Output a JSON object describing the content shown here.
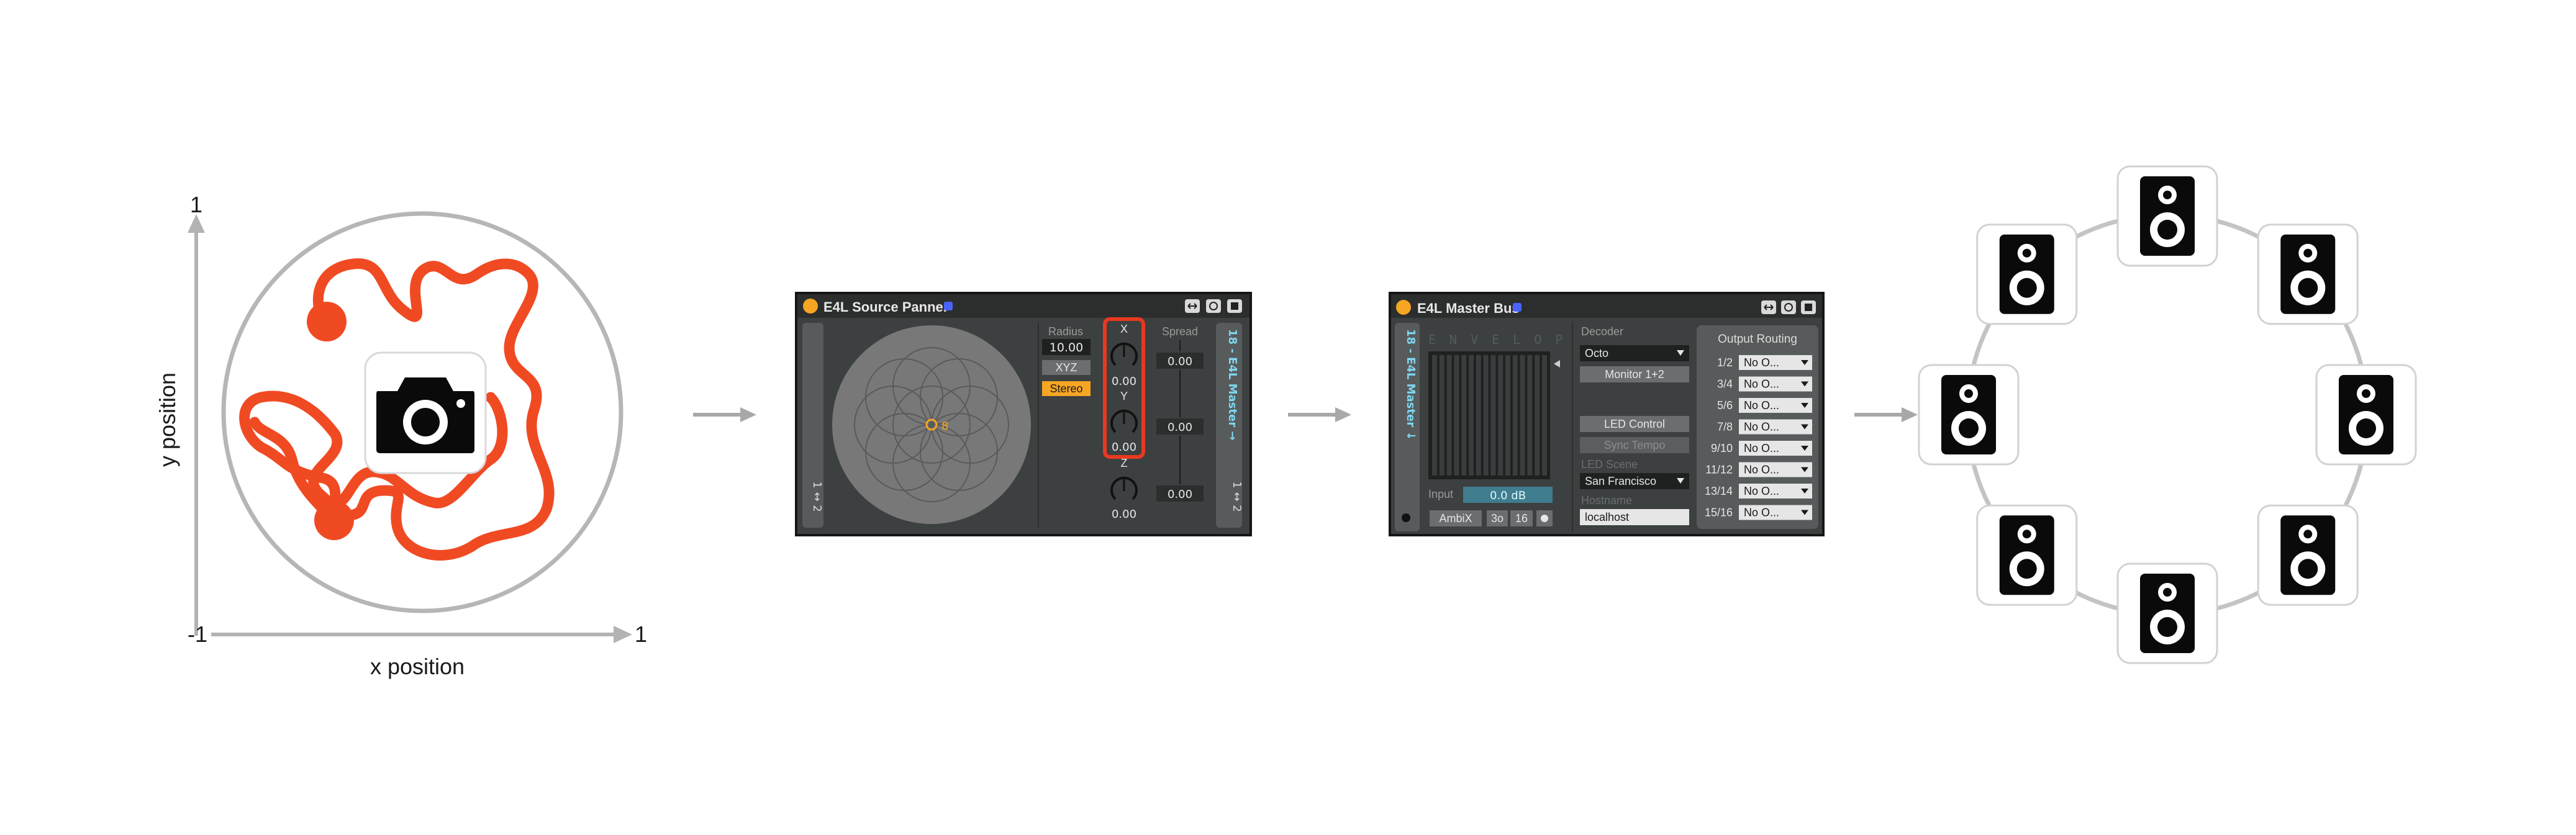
{
  "xy_plot": {
    "y_top_tick": "1",
    "y_label": "y position",
    "x_left_tick": "-1",
    "x_right_tick": "1",
    "x_label": "x position",
    "center_icon": "camera-icon",
    "path_color": "#f04a23"
  },
  "source_panner": {
    "title": "E4L Source Panner",
    "header_buttons": [
      "expand-icon",
      "refresh-icon",
      "save-icon"
    ],
    "left_strip_label": "1 ↔ 2",
    "right_strip_label_top": "18 - E4L Master →",
    "right_strip_label_bottom": "1 ↔ 2",
    "center_marker_label": "8",
    "radius_label": "Radius",
    "radius_value": "10.00",
    "xyz_button": "XYZ",
    "stereo_button": "Stereo",
    "knobs": [
      {
        "label": "X",
        "value": "0.00"
      },
      {
        "label": "Y",
        "value": "0.00"
      },
      {
        "label": "Z",
        "value": "0.00"
      }
    ],
    "spread_label": "Spread",
    "spread_values": [
      "0.00",
      "0.00",
      "0.00"
    ]
  },
  "master_bus": {
    "title": "E4L Master Bus",
    "header_buttons": [
      "expand-icon",
      "refresh-icon",
      "save-icon"
    ],
    "side_strip_label": "18 - E4L Master ↓",
    "logo_text": "ENVELOP",
    "input_label": "Input",
    "input_value": "0.0 dB",
    "ambix_button": "AmbiX",
    "order_value": "3o",
    "channels_value": "16",
    "decoder_label": "Decoder",
    "decoder_value": "Octo",
    "monitor_button": "Monitor 1+2",
    "led_control_button": "LED Control",
    "sync_tempo_button": "Sync Tempo",
    "led_scene_label": "LED Scene",
    "scene_value": "San Francisco",
    "hostname_label": "Hostname",
    "hostname_value": "localhost",
    "output_routing_label": "Output Routing",
    "routing_rows": [
      {
        "pair": "1/2",
        "value": "No O..."
      },
      {
        "pair": "3/4",
        "value": "No O..."
      },
      {
        "pair": "5/6",
        "value": "No O..."
      },
      {
        "pair": "7/8",
        "value": "No O..."
      },
      {
        "pair": "9/10",
        "value": "No O..."
      },
      {
        "pair": "11/12",
        "value": "No O..."
      },
      {
        "pair": "13/14",
        "value": "No O..."
      },
      {
        "pair": "15/16",
        "value": "No O..."
      }
    ]
  },
  "speaker_ring": {
    "speaker_icon": "speaker-icon",
    "speaker_count": 8
  },
  "flow_arrows": 3
}
